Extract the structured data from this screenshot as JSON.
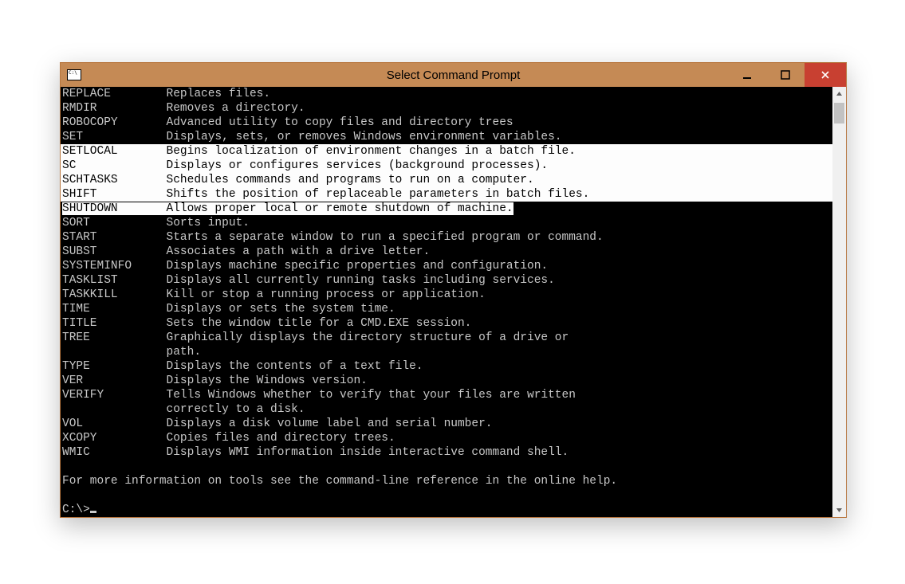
{
  "window": {
    "title": "Select Command Prompt"
  },
  "commands": [
    {
      "cmd": "REPLACE",
      "desc": "Replaces files.",
      "sel": false
    },
    {
      "cmd": "RMDIR",
      "desc": "Removes a directory.",
      "sel": false
    },
    {
      "cmd": "ROBOCOPY",
      "desc": "Advanced utility to copy files and directory trees",
      "sel": false
    },
    {
      "cmd": "SET",
      "desc": "Displays, sets, or removes Windows environment variables.",
      "sel": false
    },
    {
      "cmd": "SETLOCAL",
      "desc": "Begins localization of environment changes in a batch file.",
      "sel": true
    },
    {
      "cmd": "SC",
      "desc": "Displays or configures services (background processes).",
      "sel": true
    },
    {
      "cmd": "SCHTASKS",
      "desc": "Schedules commands and programs to run on a computer.",
      "sel": true
    },
    {
      "cmd": "SHIFT",
      "desc": "Shifts the position of replaceable parameters in batch files.",
      "sel": true
    },
    {
      "cmd": "SHUTDOWN",
      "desc": "Allows proper local or remote shutdown of machine.",
      "sel": "partial"
    },
    {
      "cmd": "SORT",
      "desc": "Sorts input.",
      "sel": false
    },
    {
      "cmd": "START",
      "desc": "Starts a separate window to run a specified program or command.",
      "sel": false
    },
    {
      "cmd": "SUBST",
      "desc": "Associates a path with a drive letter.",
      "sel": false
    },
    {
      "cmd": "SYSTEMINFO",
      "desc": "Displays machine specific properties and configuration.",
      "sel": false
    },
    {
      "cmd": "TASKLIST",
      "desc": "Displays all currently running tasks including services.",
      "sel": false
    },
    {
      "cmd": "TASKKILL",
      "desc": "Kill or stop a running process or application.",
      "sel": false
    },
    {
      "cmd": "TIME",
      "desc": "Displays or sets the system time.",
      "sel": false
    },
    {
      "cmd": "TITLE",
      "desc": "Sets the window title for a CMD.EXE session.",
      "sel": false
    },
    {
      "cmd": "TREE",
      "desc": "Graphically displays the directory structure of a drive or",
      "sel": false
    },
    {
      "cmd": "",
      "desc": "path.",
      "sel": false
    },
    {
      "cmd": "TYPE",
      "desc": "Displays the contents of a text file.",
      "sel": false
    },
    {
      "cmd": "VER",
      "desc": "Displays the Windows version.",
      "sel": false
    },
    {
      "cmd": "VERIFY",
      "desc": "Tells Windows whether to verify that your files are written",
      "sel": false
    },
    {
      "cmd": "",
      "desc": "correctly to a disk.",
      "sel": false
    },
    {
      "cmd": "VOL",
      "desc": "Displays a disk volume label and serial number.",
      "sel": false
    },
    {
      "cmd": "XCOPY",
      "desc": "Copies files and directory trees.",
      "sel": false
    },
    {
      "cmd": "WMIC",
      "desc": "Displays WMI information inside interactive command shell.",
      "sel": false
    }
  ],
  "footer": "For more information on tools see the command-line reference in the online help.",
  "prompt": "C:\\>",
  "cmdColWidth": 15
}
